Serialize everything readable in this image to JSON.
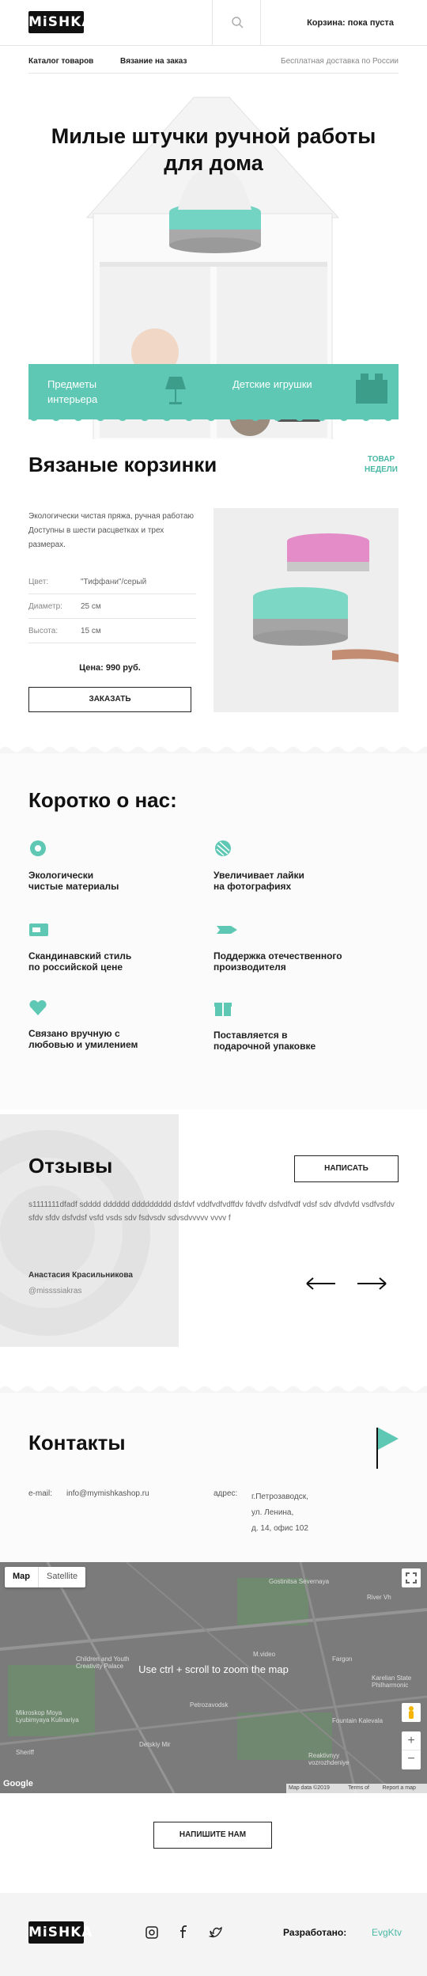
{
  "header": {
    "logo": "MiSHKA",
    "cart": "Корзина: пока пуста"
  },
  "nav": {
    "catalog": "Каталог товаров",
    "custom": "Вязание на заказ",
    "delivery": "Бесплатная доставка по России"
  },
  "hero": {
    "title": "Милые штучки ручной работы для дома",
    "cat1": "Предметы интерьера",
    "cat2": "Детские игрушки"
  },
  "product": {
    "title": "Вязаные корзинки",
    "badge_line1": "ТОВАР",
    "badge_line2": "НЕДЕЛИ",
    "description": "Экологически чистая пряжа, ручная работаю Доступны в шести расцветках и трех размерах.",
    "specs": [
      {
        "label": "Цвет:",
        "value": "\"Тиффани\"/серый"
      },
      {
        "label": "Диаметр:",
        "value": "25 см"
      },
      {
        "label": "Высота:",
        "value": "15 см"
      }
    ],
    "price": "Цена: 990 руб.",
    "order_button": "ЗАКАЗАТЬ"
  },
  "about": {
    "title": "Коротко о нас:",
    "features": [
      {
        "icon": "flower-icon",
        "text1": "Экологически",
        "text2": "чистые материалы"
      },
      {
        "icon": "yarn-icon",
        "text1": "Увеличивает лайки",
        "text2": "на фотографиях"
      },
      {
        "icon": "card-icon",
        "text1": "Скандинавский стиль",
        "text2": "по российской цене"
      },
      {
        "icon": "rocket-icon",
        "text1": "Поддержка отечественного",
        "text2": "производителя"
      },
      {
        "icon": "heart-icon",
        "text1": "Связано вручную с",
        "text2": "любовью и умилением"
      },
      {
        "icon": "gift-icon",
        "text1": "Поставляется в",
        "text2": "подарочной упаковке"
      }
    ]
  },
  "reviews": {
    "title": "Отзывы",
    "write_button": "НАПИСАТЬ",
    "text": "s1111111dfadf sdddd dddddd ddddddddd dsfdvf vddfvdfvdffdv fdvdfv dsfvdfvdf vdsf sdv dfvdvfd vsdfvsfdv sfdv sfdv dsfvdsf vsfd vsds sdv fsdvsdv sdvsdvvvvv vvvv f",
    "author": "Анастасия Красильникова",
    "handle": "@missssiakras"
  },
  "contacts": {
    "title": "Контакты",
    "email_label": "e-mail:",
    "email": "info@mymishkashop.ru",
    "address_label": "адрес:",
    "address1": "г.Петрозаводск,",
    "address2": "ул. Ленина,",
    "address3": "д. 14, офис 102"
  },
  "map": {
    "tab_map": "Map",
    "tab_satellite": "Satellite",
    "overlay": "Use ctrl + scroll to zoom the map",
    "attribution": "Map data ©2019 Google",
    "terms": "Terms of Use",
    "report": "Report a map error",
    "google": "Google",
    "labels": [
      "Gostinitsa Severnaya",
      "River Vh",
      "Children and Youth Creativity Palace",
      "M.video",
      "Fargon",
      "Karelian State Philharmonic",
      "Petrozavodsk",
      "Fountain Kalevala",
      "Sheriff",
      "Detskiy Mir",
      "Mikroskop Moya Lyubimyaya Kulinariya",
      "Reaktivnyy vozrozhdeniye"
    ]
  },
  "write_us_button": "НАПИШИТЕ НАМ",
  "footer": {
    "logo": "MiSHKA",
    "dev_label": "Разработано:",
    "dev_name": "EvgKtv"
  },
  "colors": {
    "accent": "#5fc8b4",
    "accent_text": "#4bb8a6",
    "dark": "#111111",
    "map": "#7b7b7b"
  }
}
